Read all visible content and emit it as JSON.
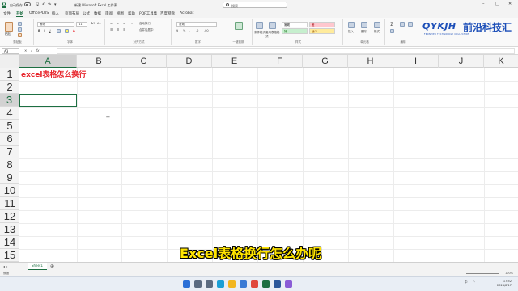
{
  "titlebar": {
    "autosave_label": "自动保存",
    "document_title": "新建 Microsoft Excel 工作表",
    "search_placeholder": "搜索",
    "app_icon": "X"
  },
  "ribbon_tabs": [
    "文件",
    "开始",
    "OfficePLUS",
    "插入",
    "页面布局",
    "公式",
    "数据",
    "审阅",
    "视图",
    "帮助",
    "PDF工具集",
    "百度网盘",
    "Acrobat"
  ],
  "ribbon": {
    "font_name": "等线",
    "font_size": "11",
    "groups": {
      "clipboard": "剪贴板",
      "font": "字体",
      "alignment": "对齐方式",
      "number": "数字",
      "dumb_plugin": "一键到期",
      "styles": "样式",
      "cells": "单元格",
      "editing": "编辑"
    },
    "paste_label": "粘贴",
    "wrap_label": "自动换行",
    "merge_label": "合并后居中",
    "number_format": "常规",
    "cond_format_label": "条件格式",
    "table_format_label": "套用表格格式",
    "style_normal": "常规",
    "style_bad": "差",
    "style_good": "好",
    "style_neutral": "适中",
    "insert_label": "插入",
    "delete_label": "删除",
    "format_label": "格式"
  },
  "logo": {
    "latin": "QYKJH",
    "cjk": "前沿科技汇",
    "sub": "FRONTIER TECHNOLOGY COLLECTION"
  },
  "formula_bar": {
    "name_box": "A3",
    "fx": "fx"
  },
  "columns": [
    "A",
    "B",
    "C",
    "D",
    "E",
    "F",
    "G",
    "H",
    "I",
    "J",
    "K"
  ],
  "rows": [
    "1",
    "2",
    "3",
    "4",
    "5",
    "6",
    "7",
    "8",
    "9",
    "10",
    "11",
    "12",
    "13",
    "14",
    "15"
  ],
  "cells": {
    "A1": "excel表格怎么换行"
  },
  "selected": {
    "column": "A",
    "row": "3"
  },
  "caption": "Excel表格换行怎么办呢",
  "sheets": [
    "Sheet1"
  ],
  "status": {
    "ready": "就绪",
    "zoom": "100%"
  },
  "taskbar": {
    "time": "17:52",
    "date": "2024/8/17",
    "lang": "中",
    "icons": [
      {
        "name": "windows-start-icon",
        "color": "#2b6fd6"
      },
      {
        "name": "search-icon",
        "color": "#5b6b80"
      },
      {
        "name": "task-view-icon",
        "color": "#5b6b80"
      },
      {
        "name": "edge-icon",
        "color": "#1a9fd6"
      },
      {
        "name": "file-explorer-icon",
        "color": "#f2b61f"
      },
      {
        "name": "store-icon",
        "color": "#3a7bd5"
      },
      {
        "name": "chrome-icon",
        "color": "#e0483c"
      },
      {
        "name": "excel-icon",
        "color": "#1d6f42"
      },
      {
        "name": "word-icon",
        "color": "#2b579a"
      },
      {
        "name": "app-icon",
        "color": "#8a5cd6"
      }
    ]
  }
}
